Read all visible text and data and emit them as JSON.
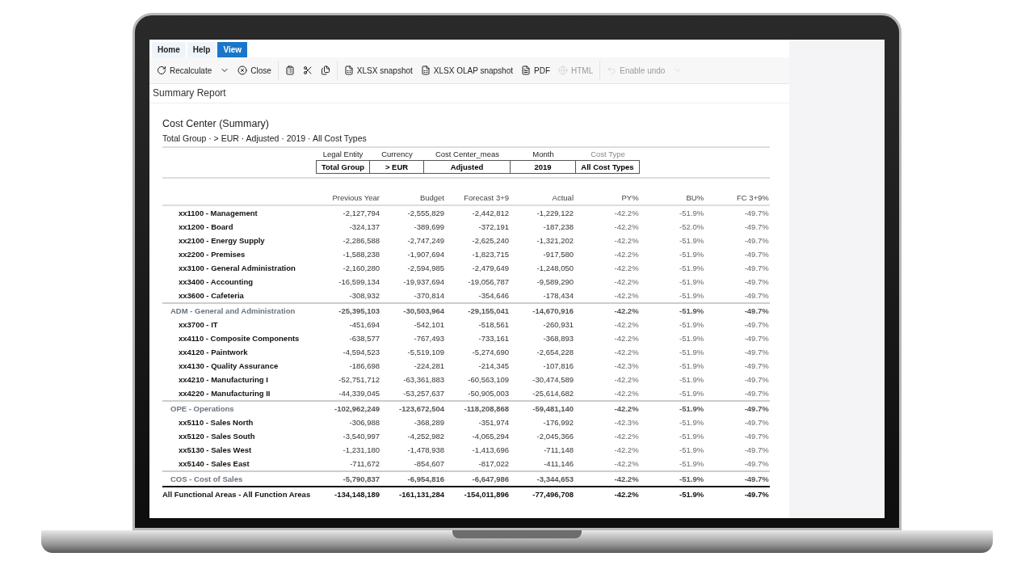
{
  "menu_tabs": [
    {
      "label": "Home",
      "selected": false
    },
    {
      "label": "Help",
      "selected": false
    },
    {
      "label": "View",
      "selected": true
    }
  ],
  "toolbar": [
    {
      "kind": "recalculate",
      "label": "Recalculate",
      "disabled": false
    },
    {
      "kind": "dropdown",
      "disabled": false
    },
    {
      "kind": "close",
      "label": "Close",
      "disabled": false
    },
    {
      "kind": "paste",
      "disabled": false
    },
    {
      "kind": "cut",
      "disabled": false
    },
    {
      "kind": "copy",
      "disabled": false
    },
    {
      "kind": "xlsx",
      "label": "XLSX snapshot",
      "disabled": false
    },
    {
      "kind": "xlsx",
      "label": "XLSX OLAP snapshot",
      "disabled": false
    },
    {
      "kind": "pdf",
      "label": "PDF",
      "disabled": false
    },
    {
      "kind": "html",
      "label": "HTML",
      "disabled": true
    },
    {
      "kind": "undo",
      "label": "Enable undo",
      "disabled": true
    },
    {
      "kind": "dropdown",
      "disabled": true
    }
  ],
  "page_title": "Summary Report",
  "report": {
    "title": "Cost Center (Summary)",
    "breadcrumb": "Total Group · > EUR · Adjusted · 2019 · All Cost Types",
    "filters": [
      {
        "label": "Legal Entity",
        "value": "Total Group",
        "disabled": false
      },
      {
        "label": "Currency",
        "value": "> EUR",
        "disabled": false
      },
      {
        "label": "Cost Center_meas",
        "value": "Adjusted",
        "disabled": false
      },
      {
        "label": "Month",
        "value": "2019",
        "disabled": false
      },
      {
        "label": "Cost Type",
        "value": "All Cost Types",
        "disabled": true
      }
    ],
    "columns": [
      "Previous Year",
      "Budget",
      "Forecast 3+9",
      "Actual",
      "PY%",
      "BU%",
      "FC 3+9%"
    ],
    "rows": [
      {
        "kind": "item",
        "label": "xx1100 - Management",
        "values": [
          "-2,127,794",
          "-2,555,829",
          "-2,442,812",
          "-1,229,122",
          "-42.2%",
          "-51.9%",
          "-49.7%"
        ]
      },
      {
        "kind": "item",
        "label": "xx1200 - Board",
        "values": [
          "-324,137",
          "-389,699",
          "-372,191",
          "-187,238",
          "-42.2%",
          "-52.0%",
          "-49.7%"
        ]
      },
      {
        "kind": "item",
        "label": "xx2100 - Energy Supply",
        "values": [
          "-2,286,588",
          "-2,747,249",
          "-2,625,240",
          "-1,321,202",
          "-42.2%",
          "-51.9%",
          "-49.7%"
        ]
      },
      {
        "kind": "item",
        "label": "xx2200 - Premises",
        "values": [
          "-1,588,238",
          "-1,907,694",
          "-1,823,715",
          "-917,580",
          "-42.2%",
          "-51.9%",
          "-49.7%"
        ]
      },
      {
        "kind": "item",
        "label": "xx3100 - General Administration",
        "values": [
          "-2,160,280",
          "-2,594,985",
          "-2,479,649",
          "-1,248,050",
          "-42.2%",
          "-51.9%",
          "-49.7%"
        ]
      },
      {
        "kind": "item",
        "label": "xx3400 - Accounting",
        "values": [
          "-16,599,134",
          "-19,937,694",
          "-19,056,787",
          "-9,589,290",
          "-42.2%",
          "-51.9%",
          "-49.7%"
        ]
      },
      {
        "kind": "item",
        "label": "xx3600 - Cafeteria",
        "values": [
          "-308,932",
          "-370,814",
          "-354,646",
          "-178,434",
          "-42.2%",
          "-51.9%",
          "-49.7%"
        ]
      },
      {
        "kind": "subtotal",
        "label": "ADM - General and Administration",
        "values": [
          "-25,395,103",
          "-30,503,964",
          "-29,155,041",
          "-14,670,916",
          "-42.2%",
          "-51.9%",
          "-49.7%"
        ]
      },
      {
        "kind": "item",
        "label": "xx3700 - IT",
        "values": [
          "-451,694",
          "-542,101",
          "-518,561",
          "-260,931",
          "-42.2%",
          "-51.9%",
          "-49.7%"
        ]
      },
      {
        "kind": "item",
        "label": "xx4110 - Composite Components",
        "values": [
          "-638,577",
          "-767,493",
          "-733,161",
          "-368,893",
          "-42.2%",
          "-51.9%",
          "-49.7%"
        ]
      },
      {
        "kind": "item",
        "label": "xx4120 - Paintwork",
        "values": [
          "-4,594,523",
          "-5,519,109",
          "-5,274,690",
          "-2,654,228",
          "-42.2%",
          "-51.9%",
          "-49.7%"
        ]
      },
      {
        "kind": "item",
        "label": "xx4130 - Quality Assurance",
        "values": [
          "-186,698",
          "-224,281",
          "-214,345",
          "-107,816",
          "-42.3%",
          "-51.9%",
          "-49.7%"
        ]
      },
      {
        "kind": "item",
        "label": "xx4210 - Manufacturing I",
        "values": [
          "-52,751,712",
          "-63,361,883",
          "-60,563,109",
          "-30,474,589",
          "-42.2%",
          "-51.9%",
          "-49.7%"
        ]
      },
      {
        "kind": "item",
        "label": "xx4220 - Manufacturing II",
        "values": [
          "-44,339,045",
          "-53,257,637",
          "-50,905,003",
          "-25,614,682",
          "-42.2%",
          "-51.9%",
          "-49.7%"
        ]
      },
      {
        "kind": "subtotal",
        "label": "OPE - Operations",
        "values": [
          "-102,962,249",
          "-123,672,504",
          "-118,208,868",
          "-59,481,140",
          "-42.2%",
          "-51.9%",
          "-49.7%"
        ]
      },
      {
        "kind": "item",
        "label": "xx5110 - Sales North",
        "values": [
          "-306,988",
          "-368,289",
          "-351,974",
          "-176,992",
          "-42.3%",
          "-51.9%",
          "-49.7%"
        ]
      },
      {
        "kind": "item",
        "label": "xx5120 - Sales South",
        "values": [
          "-3,540,997",
          "-4,252,982",
          "-4,065,294",
          "-2,045,366",
          "-42.2%",
          "-51.9%",
          "-49.7%"
        ]
      },
      {
        "kind": "item",
        "label": "xx5130 - Sales West",
        "values": [
          "-1,231,180",
          "-1,478,938",
          "-1,413,696",
          "-711,148",
          "-42.2%",
          "-51.9%",
          "-49.7%"
        ]
      },
      {
        "kind": "item",
        "label": "xx5140 - Sales East",
        "values": [
          "-711,672",
          "-854,607",
          "-817,022",
          "-411,146",
          "-42.2%",
          "-51.9%",
          "-49.7%"
        ]
      },
      {
        "kind": "subtotal",
        "label": "COS - Cost of Sales",
        "values": [
          "-5,790,837",
          "-6,954,816",
          "-6,647,986",
          "-3,344,653",
          "-42.2%",
          "-51.9%",
          "-49.7%"
        ]
      },
      {
        "kind": "total",
        "label": "All Functional Areas - All Function Areas",
        "values": [
          "-134,148,189",
          "-161,131,284",
          "-154,011,896",
          "-77,496,708",
          "-42.2%",
          "-51.9%",
          "-49.7%"
        ]
      }
    ]
  }
}
